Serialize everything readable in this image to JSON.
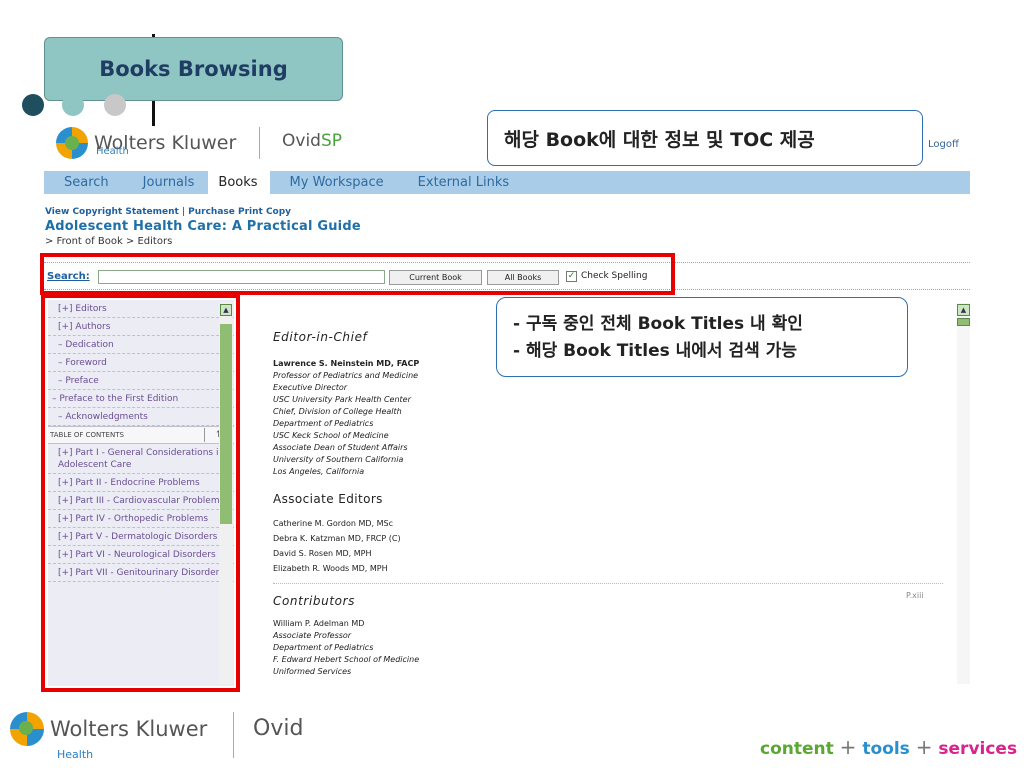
{
  "slide": {
    "title": "Books Browsing",
    "dot_colors": [
      "#1f4e5f",
      "#8fc6c3",
      "#c8c8c8"
    ]
  },
  "header": {
    "brand": "Wolters Kluwer",
    "brand_sub": "Health",
    "product": "Ovid",
    "product_accent": "SP",
    "logoff": "Logoff"
  },
  "callout_top": "해당 Book에 대한 정보 및 TOC 제공",
  "nav": {
    "tabs": [
      {
        "label": "Search"
      },
      {
        "label": "Journals"
      },
      {
        "label": "Books"
      },
      {
        "label": "My Workspace"
      },
      {
        "label": "External Links"
      }
    ],
    "active": "Books"
  },
  "book": {
    "link_copyright": "View Copyright Statement",
    "separator": "|",
    "link_purchase": "Purchase Print Copy",
    "title": "Adolescent Health Care: A Practical Guide",
    "breadcrumb": "> Front of Book > Editors"
  },
  "search": {
    "label": "Search:",
    "value": "",
    "current_book_button": "Current Book",
    "all_books_button": "All Books",
    "check_spelling_label": "Check Spelling",
    "check_spelling_checked": true
  },
  "callout_search": {
    "line1": "- 구독 중인 전체 Book Titles 내 확인",
    "line2": "- 해당 Book Titles 내에서 검색 가능"
  },
  "toc": {
    "front_items": [
      {
        "label": "[+] Editors"
      },
      {
        "label": "[+] Authors"
      },
      {
        "label": "–  Dedication"
      },
      {
        "label": "–  Foreword"
      },
      {
        "label": "–  Preface"
      },
      {
        "label": "–  Preface to the First Edition"
      },
      {
        "label": "–  Acknowledgments"
      }
    ],
    "heading": "TABLE OF CONTENTS",
    "up_arrow": "↑",
    "parts": [
      {
        "label": "[+] Part I - General Considerations in Adolescent Care"
      },
      {
        "label": "[+] Part II - Endocrine Problems"
      },
      {
        "label": "[+] Part III - Cardiovascular Problems"
      },
      {
        "label": "[+] Part IV - Orthopedic Problems"
      },
      {
        "label": "[+] Part V - Dermatologic Disorders"
      },
      {
        "label": "[+] Part VI - Neurological Disorders"
      },
      {
        "label": "[+] Part VII - Genitourinary Disorders"
      }
    ]
  },
  "content": {
    "editor_in_chief_heading": "Editor-in-Chief",
    "editor_in_chief_name": "Lawrence S. Neinstein MD, FACP",
    "editor_in_chief_lines": [
      "Professor of Pediatrics and Medicine",
      "Executive Director",
      "USC University Park Health Center",
      "Chief, Division of College Health",
      "Department of Pediatrics",
      "USC Keck School of Medicine",
      "Associate Dean of Student Affairs",
      "University of Southern California",
      "Los Angeles, California"
    ],
    "associate_editors_heading": "Associate Editors",
    "associate_editors": [
      "Catherine M. Gordon MD, MSc",
      "Debra K. Katzman MD, FRCP (C)",
      "David S. Rosen MD, MPH",
      "Elizabeth R. Woods MD, MPH"
    ],
    "page_number": "P.xiii",
    "contributors_heading": "Contributors",
    "contributor_name": "William P. Adelman MD",
    "contributor_lines": [
      "Associate Professor",
      "Department of Pediatrics",
      "F. Edward Hebert School of Medicine",
      "Uniformed Services"
    ]
  },
  "footer": {
    "brand": "Wolters Kluwer",
    "brand_sub": "Health",
    "product": "Ovid",
    "tagline_content": "content",
    "tagline_plus": "+",
    "tagline_tools": "tools",
    "tagline_services": "services"
  },
  "colors": {
    "nav_bg": "#a9cde9",
    "highlight_red": "#e60000",
    "callout_border": "#2e6fb0",
    "title_box_bg": "#8fc6c3"
  }
}
